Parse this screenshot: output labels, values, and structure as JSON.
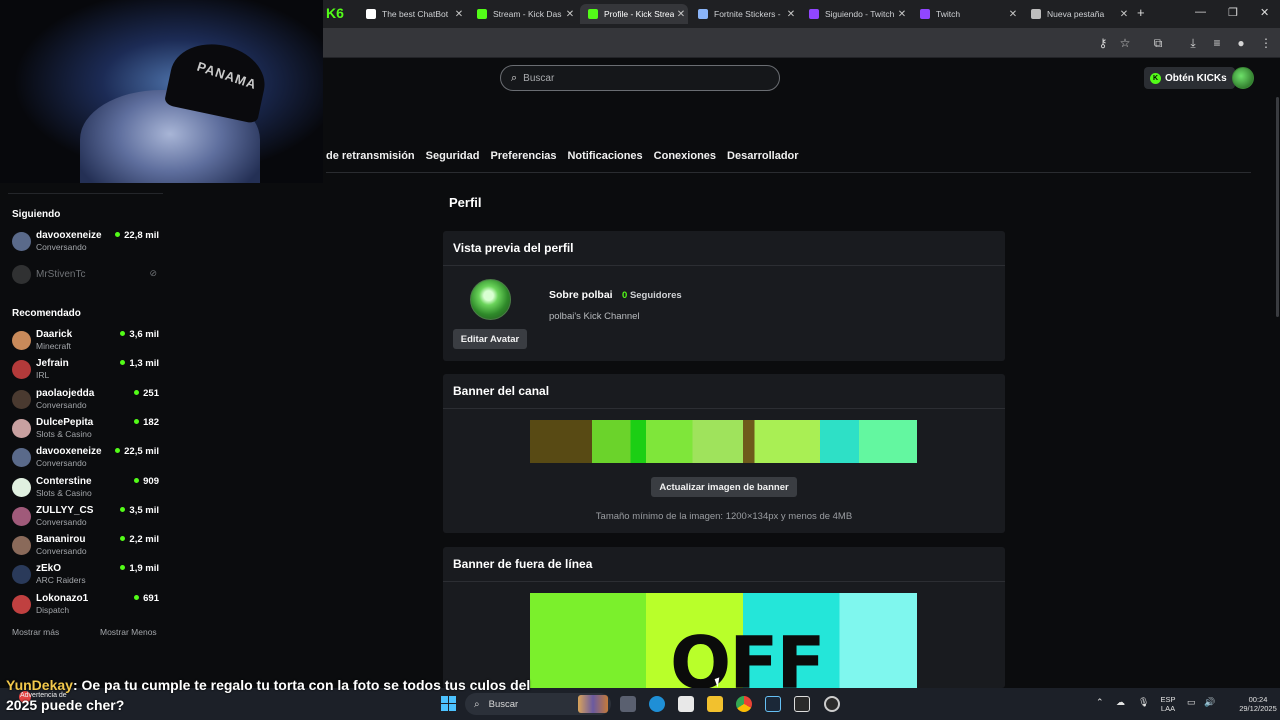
{
  "browser": {
    "tabs": [
      {
        "label": "The best ChatBot",
        "favicon_color": "#ffffff"
      },
      {
        "label": "Stream - Kick Das",
        "favicon_color": "#53fc18"
      },
      {
        "label": "Profile - Kick Strea",
        "favicon_color": "#53fc18",
        "active": true
      },
      {
        "label": "Fortnite Stickers -",
        "favicon_color": "#8ab4f8"
      },
      {
        "label": "Siguiendo - Twitch",
        "favicon_color": "#9146ff"
      },
      {
        "label": "Twitch",
        "favicon_color": "#9146ff"
      },
      {
        "label": "Nueva pestaña",
        "favicon_color": "#bdbdbd"
      }
    ],
    "partial_logo": "K6"
  },
  "header": {
    "search_placeholder": "Buscar",
    "kicks_label": "Obtén KICKs"
  },
  "settings_nav": [
    "de retransmisión",
    "Seguridad",
    "Preferencias",
    "Notificaciones",
    "Conexiones",
    "Desarrollador"
  ],
  "main": {
    "title": "Perfil",
    "profile_card": {
      "title": "Vista previa del perfil",
      "edit_avatar": "Editar Avatar",
      "about": "Sobre polbai",
      "followers_count": "0",
      "followers_label": "Seguidores",
      "description": "polbai's Kick Channel"
    },
    "banner_card": {
      "title": "Banner del canal",
      "update_button": "Actualizar imagen de banner",
      "hint": "Tamaño mínimo de la imagen: 1200×134px y menos de 4MB"
    },
    "offline_card": {
      "title": "Banner de fuera de línea",
      "banner_text": "OFF"
    }
  },
  "sidebar": {
    "following_title": "Siguiendo",
    "following": [
      {
        "name": "davooxeneize",
        "category": "Conversando",
        "viewers": "22,8 mil",
        "avatar_color": "#5a6a8a"
      },
      {
        "name": "MrStivenTc",
        "offline": true,
        "avatar_color": "#6a6a6a"
      }
    ],
    "recommended_title": "Recomendado",
    "recommended": [
      {
        "name": "Daarick",
        "category": "Minecraft",
        "viewers": "3,6 mil",
        "avatar_color": "#c98a5a"
      },
      {
        "name": "Jefrain",
        "category": "IRL",
        "viewers": "1,3 mil",
        "avatar_color": "#b33a3a"
      },
      {
        "name": "paolaojedda",
        "category": "Conversando",
        "viewers": "251",
        "avatar_color": "#4a3a30"
      },
      {
        "name": "DulcePepita",
        "category": "Slots & Casino",
        "viewers": "182",
        "avatar_color": "#c8a0a0"
      },
      {
        "name": "davooxeneize",
        "category": "Conversando",
        "viewers": "22,5 mil",
        "avatar_color": "#5a6a8a"
      },
      {
        "name": "Conterstine",
        "category": "Slots & Casino",
        "viewers": "909",
        "avatar_color": "#e0f0e0"
      },
      {
        "name": "ZULLYY_CS",
        "category": "Conversando",
        "viewers": "3,5 mil",
        "avatar_color": "#a05a7a"
      },
      {
        "name": "Bananirou",
        "category": "Conversando",
        "viewers": "2,2 mil",
        "avatar_color": "#8a6a5a"
      },
      {
        "name": "zEkO",
        "category": "ARC Raiders",
        "viewers": "1,9 mil",
        "avatar_color": "#2a3a5a"
      },
      {
        "name": "Lokonazo1",
        "category": "Dispatch",
        "viewers": "691",
        "avatar_color": "#c04040"
      }
    ],
    "show_more": "Mostrar más",
    "show_less": "Mostrar Menos"
  },
  "webcam": {
    "cap_text": "PANAMA"
  },
  "stream_chat": {
    "user": "YunDekay",
    "message": ": Oe pa tu cumple te regalo tu torta con la foto se todos tus culos del 2025 puede cher?",
    "warning": "Advertencia de"
  },
  "taskbar": {
    "search_label": "Buscar",
    "lang_top": "ESP",
    "lang_bottom": "LAA",
    "time": "00:24",
    "date": "29/12/2025"
  }
}
